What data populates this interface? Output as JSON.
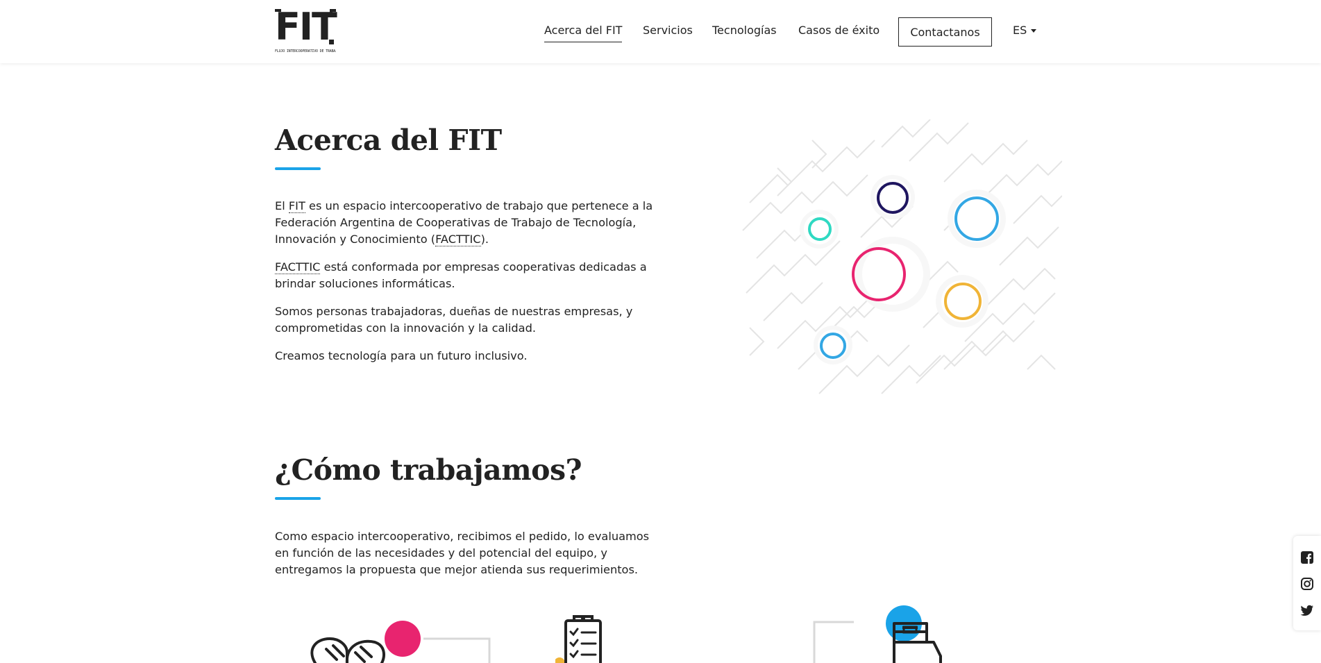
{
  "header": {
    "logo": {
      "word": "FIT",
      "tagline": "FLUJO INTERCOOPERATIVO DE TRABAJO"
    },
    "nav": [
      {
        "label": "Acerca del FIT",
        "active": true
      },
      {
        "label": "Servicios",
        "active": false
      },
      {
        "label": "Tecnologías",
        "active": false
      },
      {
        "label": "Casos de éxito",
        "active": false
      }
    ],
    "contact_label": "Contactanos",
    "language": "ES"
  },
  "about": {
    "title": "Acerca del FIT",
    "p1": {
      "a": "El ",
      "abbr1": "FIT",
      "b": " es un espacio intercooperativo de trabajo que pertenece a la Federación Argentina de Cooperativas de Trabajo de Tecnología, Innovación y Conocimiento (",
      "abbr2": "FACTTIC",
      "c": ")."
    },
    "p2": {
      "abbr": "FACTTIC",
      "text": " está conformada por empresas cooperativas dedicadas a brindar soluciones informáticas."
    },
    "p3": "Somos personas trabajadoras, dueñas de nuestras empresas, y comprometidas con la innovación y la calidad.",
    "p4": "Creamos tecnología para un futuro inclusivo."
  },
  "how": {
    "title": "¿Cómo trabajamos?",
    "p1": "Como espacio intercooperativo, recibimos el pedido, lo evaluamos en función de las necesidades y del potencial del equipo, y entregamos la propuesta que mejor atienda sus requerimientos."
  },
  "colors": {
    "accent": "#1aa3e8",
    "pink": "#e8246f",
    "navy": "#1f1660",
    "teal": "#2fd9c2",
    "gold": "#f0b437",
    "blue": "#33a7e4"
  },
  "social": [
    "facebook-icon",
    "instagram-icon",
    "twitter-icon"
  ]
}
